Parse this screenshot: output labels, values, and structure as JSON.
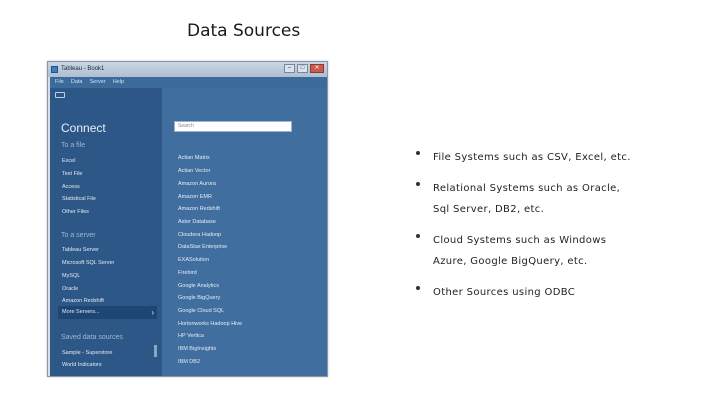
{
  "slide": {
    "title": "Data Sources"
  },
  "window": {
    "title": "Tableau - Book1",
    "menu": [
      "File",
      "Data",
      "Server",
      "Help"
    ]
  },
  "connect": {
    "title": "Connect",
    "to_file": {
      "heading": "To a file",
      "items": [
        "Excel",
        "Text File",
        "Access",
        "Statistical File",
        "Other Files"
      ]
    },
    "to_server": {
      "heading": "To a server",
      "items": [
        "Tableau Server",
        "Microsoft SQL Server",
        "MySQL",
        "Oracle",
        "Amazon Redshift",
        "More Servers..."
      ]
    },
    "saved": {
      "heading": "Saved data sources",
      "items": [
        "Sample - Superstore",
        "World Indicators"
      ]
    }
  },
  "search": {
    "placeholder": "Search"
  },
  "servers": [
    "Actian Matrix",
    "Actian Vector",
    "Amazon Aurora",
    "Amazon EMR",
    "Amazon Redshift",
    "Aster Database",
    "Cloudera Hadoop",
    "DataStax Enterprise",
    "EXASolution",
    "Firebird",
    "Google Analytics",
    "Google BigQuery",
    "Google Cloud SQL",
    "Hortonworks Hadoop Hive",
    "HP Vertica",
    "IBM BigInsights",
    "IBM DB2"
  ],
  "bullets": [
    "File Systems such as CSV, Excel, etc.",
    "Relational Systems such as Oracle, Sql Server, DB2, etc.",
    "Cloud Systems such as Windows Azure, Google BigQuery, etc.",
    "Other Sources using ODBC"
  ],
  "colors": {
    "left_pane": "#2d5786",
    "right_pane": "#3f6e9f",
    "selected_row": "#1f4673"
  }
}
